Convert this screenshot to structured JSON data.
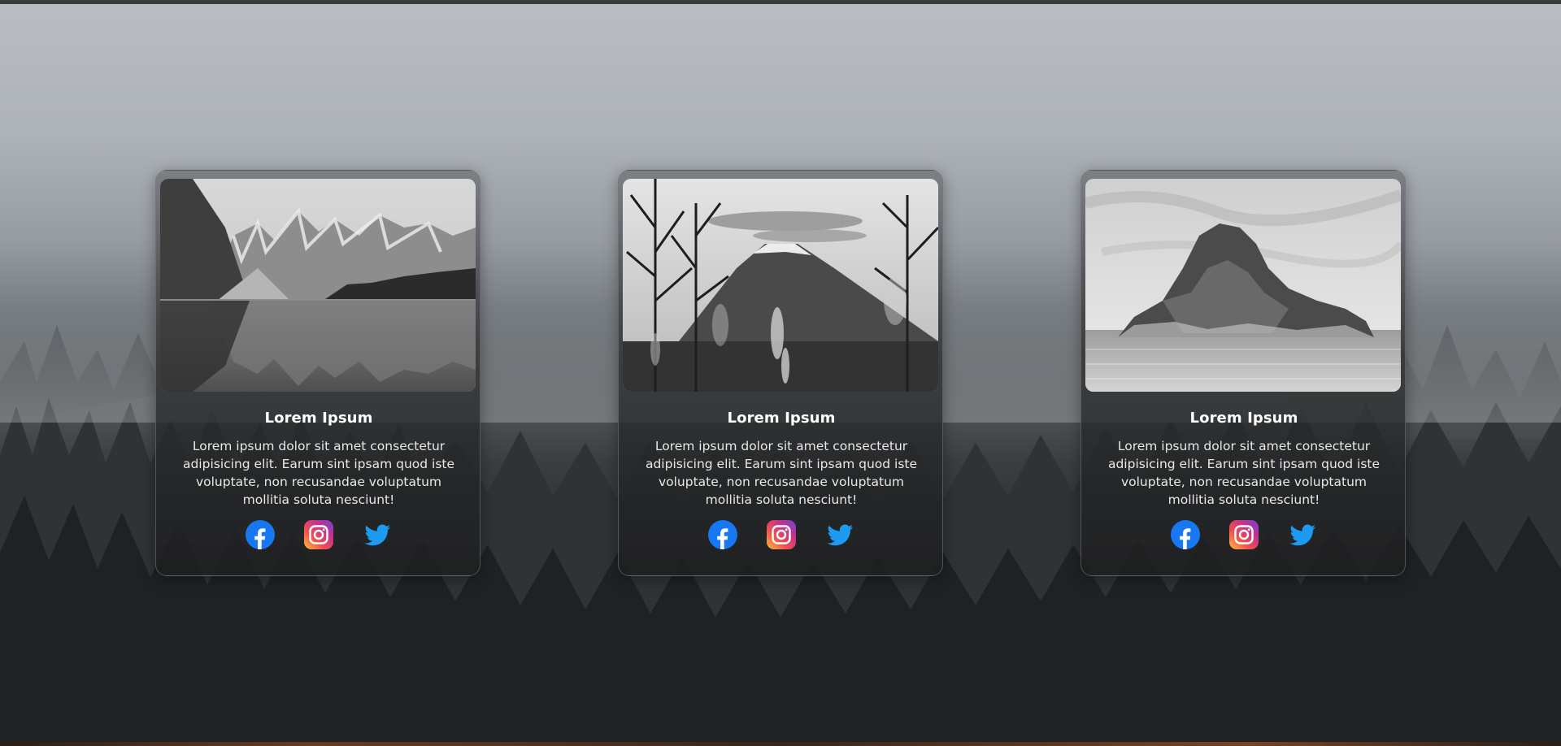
{
  "cards": [
    {
      "title": "Lorem Ipsum",
      "text": "Lorem ipsum dolor sit amet consectetur adipisicing elit. Earum sint ipsam quod iste voluptate, non recusandae voluptatum mollitia soluta nesciunt!",
      "image": "mountain-lake-photo",
      "social": [
        "facebook-icon",
        "instagram-icon",
        "twitter-icon"
      ]
    },
    {
      "title": "Lorem Ipsum",
      "text": "Lorem ipsum dolor sit amet consectetur adipisicing elit. Earum sint ipsam quod iste voluptate, non recusandae voluptatum mollitia soluta nesciunt!",
      "image": "volcano-trees-photo",
      "social": [
        "facebook-icon",
        "instagram-icon",
        "twitter-icon"
      ]
    },
    {
      "title": "Lorem Ipsum",
      "text": "Lorem ipsum dolor sit amet consectetur adipisicing elit. Earum sint ipsam quod iste voluptate, non recusandae voluptatum mollitia soluta nesciunt!",
      "image": "rock-island-photo",
      "social": [
        "facebook-icon",
        "instagram-icon",
        "twitter-icon"
      ]
    }
  ],
  "background": "foggy-forest",
  "colors": {
    "facebook": "#1877f2",
    "twitter": "#1d9bf0",
    "card_title": "#ffffff",
    "card_text": "#e9e9e9"
  }
}
